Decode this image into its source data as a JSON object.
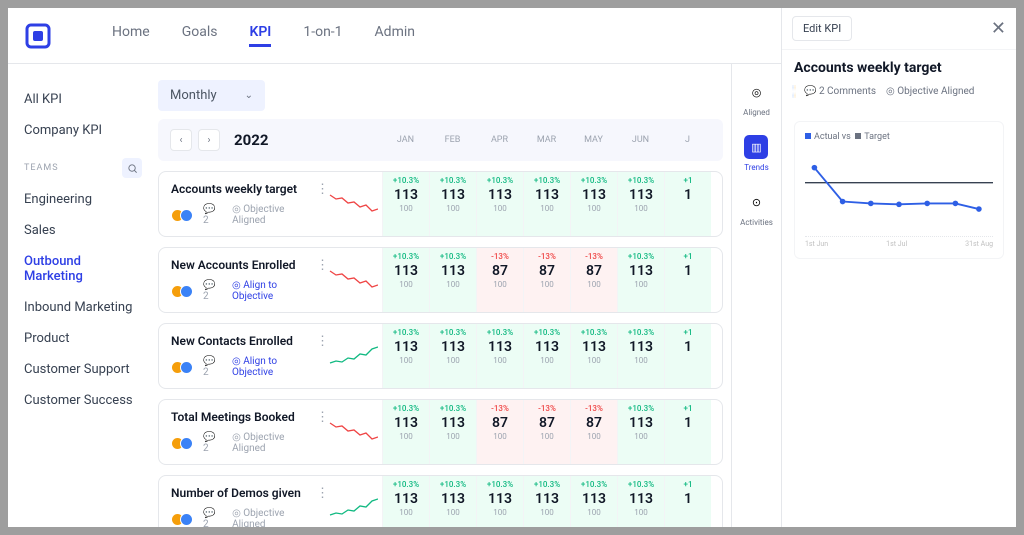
{
  "nav": {
    "items": [
      "Home",
      "Goals",
      "KPI",
      "1-on-1",
      "Admin"
    ],
    "active": "KPI"
  },
  "sidebar": {
    "top": [
      "All KPI",
      "Company KPI"
    ],
    "teams_label": "TEAMS",
    "teams": [
      "Engineering",
      "Sales",
      "Outbound Marketing",
      "Inbound Marketing",
      "Product",
      "Customer Support",
      "Customer Success"
    ],
    "active": "Outbound Marketing"
  },
  "period": {
    "label": "Monthly"
  },
  "year_bar": {
    "year": "2022",
    "months": [
      "JAN",
      "FEB",
      "APR",
      "MAR",
      "MAY",
      "JUN",
      "J"
    ]
  },
  "kpis": [
    {
      "title": "Accounts weekly target",
      "comments": "2",
      "status": "Objective Aligned",
      "status_link": false,
      "spark": "down-red",
      "cells": [
        {
          "pct": "+10.3%",
          "val": "113",
          "tgt": "100",
          "c": "pos"
        },
        {
          "pct": "+10.3%",
          "val": "113",
          "tgt": "100",
          "c": "pos"
        },
        {
          "pct": "+10.3%",
          "val": "113",
          "tgt": "100",
          "c": "pos"
        },
        {
          "pct": "+10.3%",
          "val": "113",
          "tgt": "100",
          "c": "pos"
        },
        {
          "pct": "+10.3%",
          "val": "113",
          "tgt": "100",
          "c": "pos"
        },
        {
          "pct": "+10.3%",
          "val": "113",
          "tgt": "100",
          "c": "pos"
        },
        {
          "pct": "+1",
          "val": "1",
          "tgt": "",
          "c": "pos"
        }
      ]
    },
    {
      "title": "New Accounts Enrolled",
      "comments": "2",
      "status": "Align to Objective",
      "status_link": true,
      "spark": "down-red",
      "cells": [
        {
          "pct": "+10.3%",
          "val": "113",
          "tgt": "100",
          "c": "pos"
        },
        {
          "pct": "+10.3%",
          "val": "113",
          "tgt": "100",
          "c": "pos"
        },
        {
          "pct": "-13%",
          "val": "87",
          "tgt": "100",
          "c": "neg"
        },
        {
          "pct": "-13%",
          "val": "87",
          "tgt": "100",
          "c": "neg"
        },
        {
          "pct": "-13%",
          "val": "87",
          "tgt": "100",
          "c": "neg"
        },
        {
          "pct": "+10.3%",
          "val": "113",
          "tgt": "100",
          "c": "pos"
        },
        {
          "pct": "+1",
          "val": "1",
          "tgt": "",
          "c": "pos"
        }
      ]
    },
    {
      "title": "New Contacts Enrolled",
      "comments": "2",
      "status": "Align to Objective",
      "status_link": true,
      "spark": "up-green",
      "cells": [
        {
          "pct": "+10.3%",
          "val": "113",
          "tgt": "100",
          "c": "pos"
        },
        {
          "pct": "+10.3%",
          "val": "113",
          "tgt": "100",
          "c": "pos"
        },
        {
          "pct": "+10.3%",
          "val": "113",
          "tgt": "100",
          "c": "pos"
        },
        {
          "pct": "+10.3%",
          "val": "113",
          "tgt": "100",
          "c": "pos"
        },
        {
          "pct": "+10.3%",
          "val": "113",
          "tgt": "100",
          "c": "pos"
        },
        {
          "pct": "+10.3%",
          "val": "113",
          "tgt": "100",
          "c": "pos"
        },
        {
          "pct": "+1",
          "val": "1",
          "tgt": "",
          "c": "pos"
        }
      ]
    },
    {
      "title": "Total Meetings Booked",
      "comments": "2",
      "status": "Objective Aligned",
      "status_link": false,
      "spark": "down-red",
      "cells": [
        {
          "pct": "+10.3%",
          "val": "113",
          "tgt": "100",
          "c": "pos"
        },
        {
          "pct": "+10.3%",
          "val": "113",
          "tgt": "100",
          "c": "pos"
        },
        {
          "pct": "-13%",
          "val": "87",
          "tgt": "100",
          "c": "neg"
        },
        {
          "pct": "-13%",
          "val": "87",
          "tgt": "100",
          "c": "neg"
        },
        {
          "pct": "-13%",
          "val": "87",
          "tgt": "100",
          "c": "neg"
        },
        {
          "pct": "+10.3%",
          "val": "113",
          "tgt": "100",
          "c": "pos"
        },
        {
          "pct": "+1",
          "val": "1",
          "tgt": "",
          "c": "pos"
        }
      ]
    },
    {
      "title": "Number of Demos given",
      "comments": "2",
      "status": "Objective Aligned",
      "status_link": false,
      "spark": "up-green",
      "cells": [
        {
          "pct": "+10.3%",
          "val": "113",
          "tgt": "100",
          "c": "pos"
        },
        {
          "pct": "+10.3%",
          "val": "113",
          "tgt": "100",
          "c": "pos"
        },
        {
          "pct": "+10.3%",
          "val": "113",
          "tgt": "100",
          "c": "pos"
        },
        {
          "pct": "+10.3%",
          "val": "113",
          "tgt": "100",
          "c": "pos"
        },
        {
          "pct": "+10.3%",
          "val": "113",
          "tgt": "100",
          "c": "pos"
        },
        {
          "pct": "+10.3%",
          "val": "113",
          "tgt": "100",
          "c": "pos"
        },
        {
          "pct": "+1",
          "val": "1",
          "tgt": "",
          "c": "pos"
        }
      ]
    }
  ],
  "rail": {
    "items": [
      {
        "label": "Aligned",
        "icon": "target"
      },
      {
        "label": "Trends",
        "icon": "chart",
        "active": true
      },
      {
        "label": "Activities",
        "icon": "pin"
      }
    ]
  },
  "panel": {
    "edit": "Edit KPI",
    "title": "Accounts weekly target",
    "comments": "2 Comments",
    "objective": "Objective Aligned",
    "legend_actual": "Actual vs",
    "legend_target": "Target",
    "xaxis": [
      "1st Jun",
      "1st Jul",
      "31st Aug"
    ]
  },
  "chart_data": {
    "type": "line",
    "title": "Accounts weekly target",
    "series": [
      {
        "name": "Actual vs",
        "values": [
          120,
          72,
          70,
          69,
          70,
          70,
          63
        ]
      },
      {
        "name": "Target",
        "values": [
          100,
          100,
          100,
          100,
          100,
          100,
          100
        ]
      }
    ],
    "x": [
      "1st Jun",
      "",
      "",
      "",
      "1st Jul",
      "",
      "31st Aug"
    ],
    "ylim": [
      50,
      130
    ]
  }
}
